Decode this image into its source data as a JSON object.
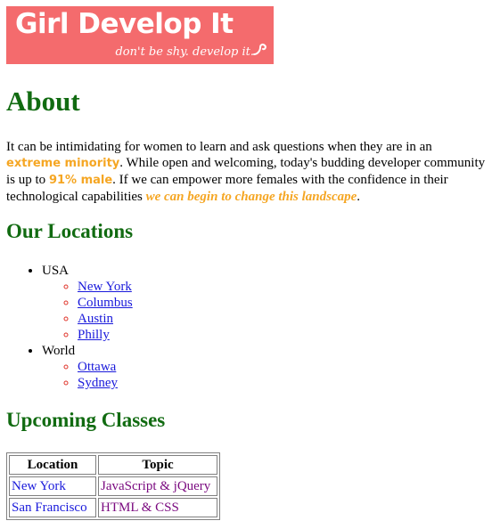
{
  "logo": {
    "title": "Girl Develop It",
    "tagline": "don't be shy. develop it.",
    "background": "#f46b6d"
  },
  "about": {
    "heading": "About",
    "text_1": "It can be intimidating for women to learn and ask questions when they are in an ",
    "highlight_1": "extreme minority",
    "text_2": ". While open and welcoming, today's budding developer community is up to ",
    "highlight_2": "91% male",
    "text_3": ". If we can empower more females with the confidence in their technological capabilities ",
    "highlight_3": "we can begin to change this landscape",
    "text_4": "."
  },
  "locations": {
    "heading": "Our Locations",
    "groups": [
      {
        "label": "USA",
        "cities": [
          "New York",
          "Columbus",
          "Austin",
          "Philly"
        ]
      },
      {
        "label": "World",
        "cities": [
          "Ottawa",
          "Sydney"
        ]
      }
    ]
  },
  "classes": {
    "heading": "Upcoming Classes",
    "columns": [
      "Location",
      "Topic"
    ],
    "rows": [
      [
        "New York",
        "JavaScript & jQuery"
      ],
      [
        "San Francisco",
        "HTML & CSS"
      ]
    ]
  },
  "colors": {
    "heading": "#116b11",
    "highlight": "#f5a623",
    "link": "#1a1adb",
    "topic": "#7b0b80"
  }
}
